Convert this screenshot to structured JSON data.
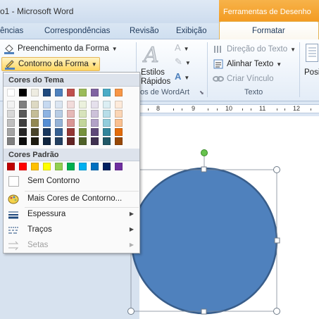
{
  "window": {
    "title": "o1 - Microsoft Word",
    "context_group": "Ferramentas de Desenho"
  },
  "tabs": [
    "ências",
    "Correspondências",
    "Revisão",
    "Exibição"
  ],
  "active_tab": "Formatar",
  "ribbon": {
    "fill_label": "Preenchimento da Forma",
    "outline_label": "Contorno da Forma",
    "styles_label_1": "Estilos",
    "styles_label_2": "Rápidos",
    "wordart_group": "os de WordArt",
    "text_direction": "Direção do Texto",
    "align_text": "Alinhar Texto",
    "create_link": "Criar Vínculo",
    "text_group": "Texto",
    "position_label": "Posi"
  },
  "ruler": {
    "numbers": [
      "8",
      "9",
      "10",
      "11",
      "12"
    ]
  },
  "menu": {
    "theme_colors_header": "Cores do Tema",
    "standard_colors_header": "Cores Padrão",
    "no_outline": "Sem Contorno",
    "more_colors": "Mais Cores de Contorno...",
    "weight": "Espessura",
    "dashes": "Traços",
    "arrows": "Setas",
    "theme_row": [
      "#ffffff",
      "#000000",
      "#eeece1",
      "#1f497d",
      "#4f81bd",
      "#c0504d",
      "#9bbb59",
      "#8064a2",
      "#4bacc6",
      "#f79646"
    ],
    "theme_shades": [
      [
        "#f2f2f2",
        "#7f7f7f",
        "#ddd9c3",
        "#c6d9f0",
        "#dbe5f1",
        "#f2dcdb",
        "#ebf1dd",
        "#e5e0ec",
        "#dbeef3",
        "#fdeada"
      ],
      [
        "#d8d8d8",
        "#595959",
        "#c4bd97",
        "#8db3e2",
        "#b8cce4",
        "#e5b9b7",
        "#d7e3bc",
        "#ccc1d9",
        "#b7dde8",
        "#fbd5b5"
      ],
      [
        "#bfbfbf",
        "#3f3f3f",
        "#938953",
        "#548dd4",
        "#95b3d7",
        "#d99694",
        "#c3d69b",
        "#b2a2c7",
        "#92cddc",
        "#fac08f"
      ],
      [
        "#a5a5a5",
        "#262626",
        "#494429",
        "#17365d",
        "#366092",
        "#953734",
        "#76923c",
        "#5f497a",
        "#31859b",
        "#e36c09"
      ],
      [
        "#7f7f7f",
        "#0c0c0c",
        "#1d1b10",
        "#0f243e",
        "#244061",
        "#632423",
        "#4f6128",
        "#3f3151",
        "#205867",
        "#974806"
      ]
    ],
    "standard_row": [
      "#c00000",
      "#ff0000",
      "#ffc000",
      "#ffff00",
      "#92d050",
      "#00b050",
      "#00b0f0",
      "#0070c0",
      "#002060",
      "#7030a0"
    ]
  },
  "shape": {
    "fill": "#4f81bd",
    "stroke": "#385d8a"
  }
}
